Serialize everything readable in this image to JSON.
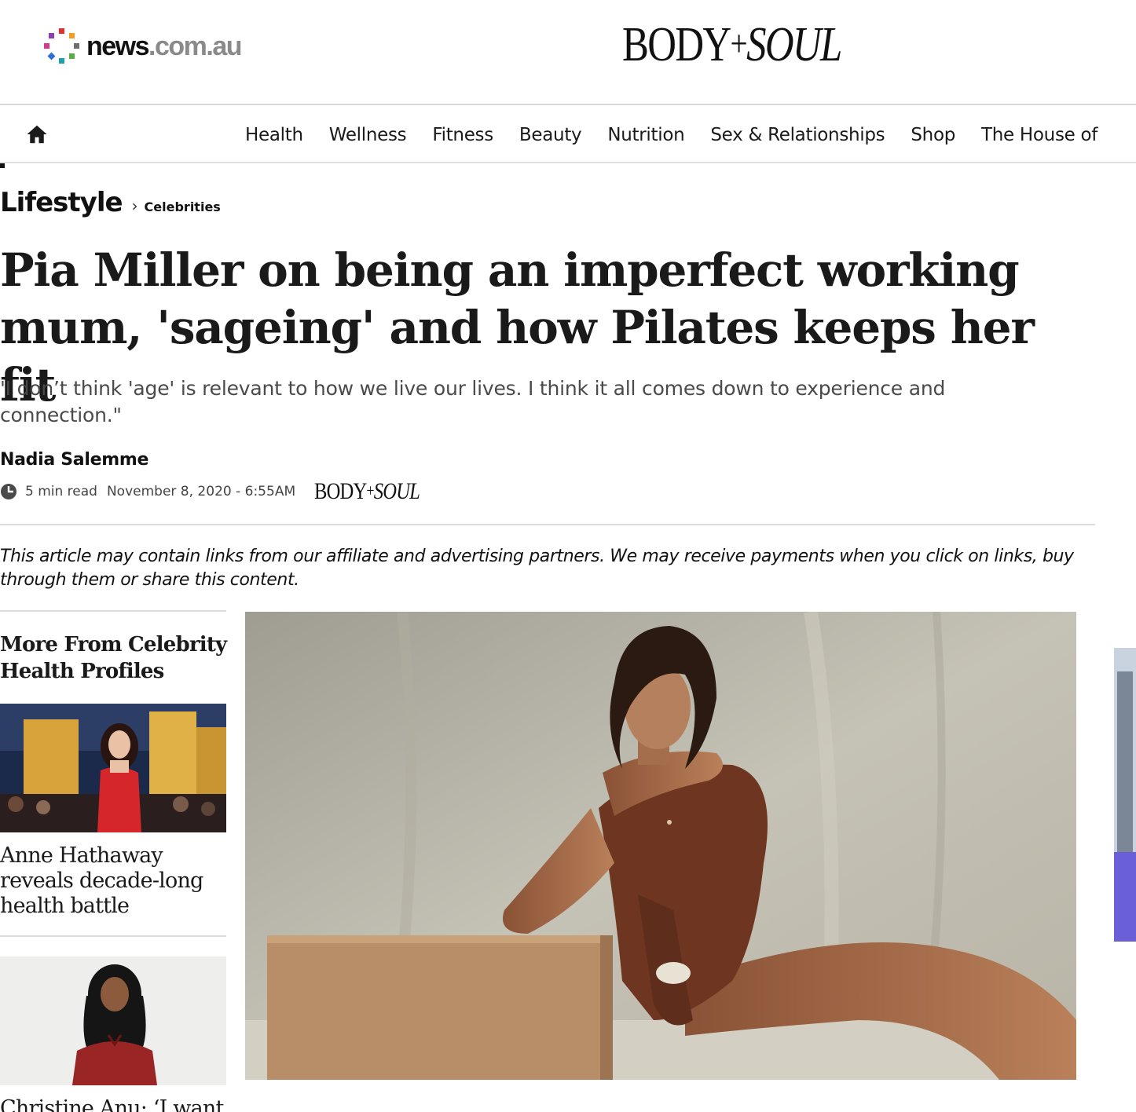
{
  "brand": {
    "news_word": "news",
    "news_domain": ".com.au",
    "bodysoul_body": "BODY",
    "bodysoul_plus": "+",
    "bodysoul_soul": "SOUL"
  },
  "nav": {
    "items": [
      {
        "label": "Health"
      },
      {
        "label": "Wellness"
      },
      {
        "label": "Fitness"
      },
      {
        "label": "Beauty"
      },
      {
        "label": "Nutrition"
      },
      {
        "label": "Sex & Relationships"
      },
      {
        "label": "Shop"
      },
      {
        "label": "The House of"
      }
    ]
  },
  "breadcrumb": {
    "section": "Lifestyle",
    "separator": "›",
    "subsection": "Celebrities"
  },
  "article": {
    "headline": "Pia Miller on being an imperfect working mum, 'sageing' and how Pilates keeps her fit",
    "standfirst": "'I don’t think 'age' is relevant to how we live our lives. I think it all comes down to experience and connection.\"",
    "author": "Nadia Salemme",
    "read_time": "5 min read",
    "published": "November 8, 2020 - 6:55AM",
    "disclaimer": "This article may contain links from our affiliate and advertising partners. We may receive payments when you click on links, buy through them or share this content."
  },
  "sidebar": {
    "title": "More From Celebrity Health Profiles",
    "cards": [
      {
        "title": "Anne Hathaway reveals decade-long health battle"
      },
      {
        "title": "Christine Anu: ‘I want"
      }
    ]
  },
  "colors": {
    "text": "#111111",
    "standfirst": "#4a4a4a",
    "rule": "#dcdcdc",
    "dot_red": "#e0312f",
    "dot_orange": "#f29d1d",
    "dot_green": "#5aac44",
    "dot_teal": "#1f9fa8",
    "dot_blue": "#2e6fd1",
    "dot_purple": "#8b3fb3",
    "dot_pink": "#d43b8a",
    "dot_gray": "#6e6e6e"
  },
  "icons": {
    "home": "home-icon",
    "clock": "clock-icon",
    "breadcrumb_separator": "chevron-right-icon"
  }
}
